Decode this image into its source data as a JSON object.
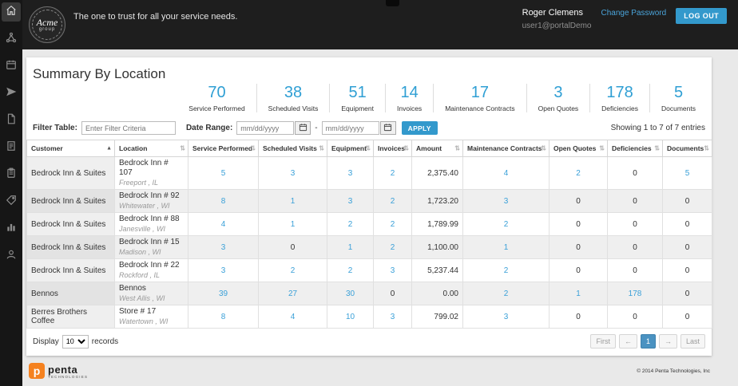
{
  "colors": {
    "accent_blue": "#3399cc",
    "kpi_blue": "#2f9fd4",
    "brand_orange": "#f58220",
    "header_bg": "#1e1e1e",
    "sidebar_bg": "#161616"
  },
  "header": {
    "logo_line1": "Acme",
    "logo_line2": "group",
    "tagline": "The one to trust for all your service needs.",
    "user_name": "Roger Clemens",
    "change_password_label": "Change Password",
    "logout_label": "LOG OUT",
    "user_email": "user1@portalDemo"
  },
  "sidebar": {
    "icons": [
      "home",
      "network",
      "calendar",
      "send",
      "file",
      "invoice",
      "clipboard",
      "tag",
      "bar-chart",
      "user"
    ]
  },
  "page": {
    "title": "Summary By Location"
  },
  "kpis": [
    {
      "value": "70",
      "label": "Service Performed"
    },
    {
      "value": "38",
      "label": "Scheduled Visits"
    },
    {
      "value": "51",
      "label": "Equipment"
    },
    {
      "value": "14",
      "label": "Invoices"
    },
    {
      "value": "17",
      "label": "Maintenance Contracts"
    },
    {
      "value": "3",
      "label": "Open Quotes"
    },
    {
      "value": "178",
      "label": "Deficiencies"
    },
    {
      "value": "5",
      "label": "Documents"
    }
  ],
  "filters": {
    "filter_label": "Filter Table:",
    "filter_placeholder": "Enter Filter Criteria",
    "date_label": "Date Range:",
    "date_placeholder": "mm/dd/yyyy",
    "range_separator": "-",
    "apply_label": "APPLY",
    "info": "Showing 1 to 7 of 7 entries"
  },
  "icons": {
    "sort_asc": "▲",
    "sort_both": "⇅"
  },
  "table": {
    "columns": [
      "Customer",
      "Location",
      "Service Performed",
      "Scheduled Visits",
      "Equipment",
      "Invoices",
      "Amount",
      "Maintenance Contracts",
      "Open Quotes",
      "Deficiencies",
      "Documents"
    ],
    "sorted_column": "Customer",
    "rows": [
      {
        "customer": "Bedrock Inn & Suites",
        "location": "Bedrock Inn # 107",
        "city": "Freeport , IL",
        "service_performed": "5",
        "scheduled_visits": "3",
        "equipment": "3",
        "invoices": "2",
        "amount": "2,375.40",
        "maintenance_contracts": "4",
        "open_quotes": "2",
        "deficiencies": "0",
        "documents": "5"
      },
      {
        "customer": "Bedrock Inn & Suites",
        "location": "Bedrock Inn # 92",
        "city": "Whitewater , WI",
        "service_performed": "8",
        "scheduled_visits": "1",
        "equipment": "3",
        "invoices": "2",
        "amount": "1,723.20",
        "maintenance_contracts": "3",
        "open_quotes": "0",
        "deficiencies": "0",
        "documents": "0"
      },
      {
        "customer": "Bedrock Inn & Suites",
        "location": "Bedrock Inn # 88",
        "city": "Janesville , WI",
        "service_performed": "4",
        "scheduled_visits": "1",
        "equipment": "2",
        "invoices": "2",
        "amount": "1,789.99",
        "maintenance_contracts": "2",
        "open_quotes": "0",
        "deficiencies": "0",
        "documents": "0"
      },
      {
        "customer": "Bedrock Inn & Suites",
        "location": "Bedrock Inn # 15",
        "city": "Madison , WI",
        "service_performed": "3",
        "scheduled_visits": "0",
        "equipment": "1",
        "invoices": "2",
        "amount": "1,100.00",
        "maintenance_contracts": "1",
        "open_quotes": "0",
        "deficiencies": "0",
        "documents": "0"
      },
      {
        "customer": "Bedrock Inn & Suites",
        "location": "Bedrock Inn # 22",
        "city": "Rockford , IL",
        "service_performed": "3",
        "scheduled_visits": "2",
        "equipment": "2",
        "invoices": "3",
        "amount": "5,237.44",
        "maintenance_contracts": "2",
        "open_quotes": "0",
        "deficiencies": "0",
        "documents": "0"
      },
      {
        "customer": "Bennos",
        "location": "Bennos",
        "city": "West Allis , WI",
        "service_performed": "39",
        "scheduled_visits": "27",
        "equipment": "30",
        "invoices": "0",
        "amount": "0.00",
        "maintenance_contracts": "2",
        "open_quotes": "1",
        "deficiencies": "178",
        "documents": "0"
      },
      {
        "customer": "Berres Brothers Coffee",
        "location": "Store # 17",
        "city": "Watertown , WI",
        "service_performed": "8",
        "scheduled_visits": "4",
        "equipment": "10",
        "invoices": "3",
        "amount": "799.02",
        "maintenance_contracts": "3",
        "open_quotes": "0",
        "deficiencies": "0",
        "documents": "0"
      }
    ]
  },
  "footer_bar": {
    "display_label": "Display",
    "display_value": "10",
    "records_label": "records",
    "pagination": [
      {
        "label": "First",
        "state": "disabled"
      },
      {
        "label": "←",
        "state": "disabled"
      },
      {
        "label": "1",
        "state": "active"
      },
      {
        "label": "→",
        "state": "disabled"
      },
      {
        "label": "Last",
        "state": "disabled"
      }
    ]
  },
  "footer": {
    "brand_letter": "p",
    "brand_name": "penta",
    "brand_sub": "TECHNOLOGIES",
    "copyright": "© 2014 Penta Technologies, Inc"
  }
}
